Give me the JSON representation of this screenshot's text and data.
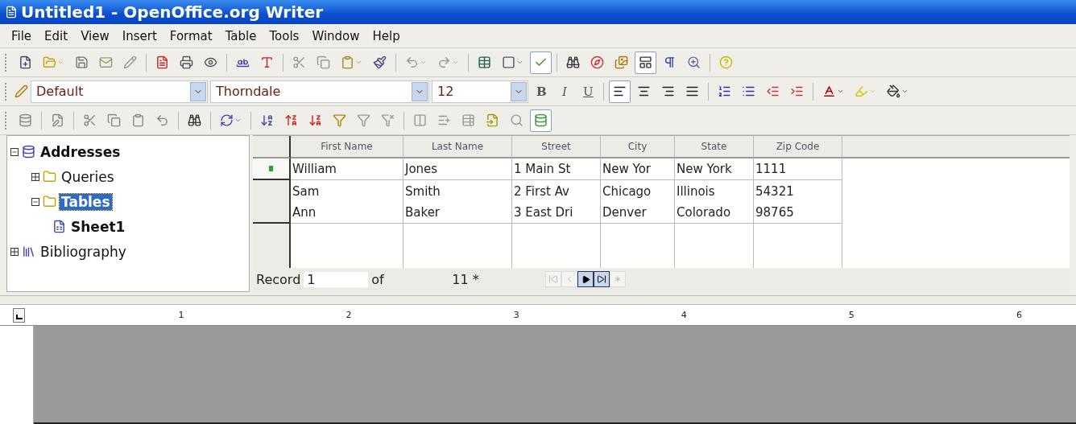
{
  "window": {
    "title": "Untitled1 - OpenOffice.org Writer"
  },
  "menu": [
    "File",
    "Edit",
    "View",
    "Insert",
    "Format",
    "Table",
    "Tools",
    "Window",
    "Help"
  ],
  "toolbar_standard": [
    {
      "kind": "button",
      "on": false
    },
    {
      "kind": "dropdown",
      "on": false
    },
    {
      "kind": "button",
      "on": false
    },
    {
      "kind": "button",
      "on": false
    },
    {
      "kind": "button",
      "on": false
    },
    {
      "kind": "separator"
    },
    {
      "kind": "button",
      "on": false
    },
    {
      "kind": "button",
      "on": false
    },
    {
      "kind": "button",
      "on": false
    },
    {
      "kind": "separator"
    },
    {
      "kind": "button",
      "on": false
    },
    {
      "kind": "button",
      "on": false
    },
    {
      "kind": "separator"
    },
    {
      "kind": "button",
      "on": false
    },
    {
      "kind": "button",
      "on": false
    },
    {
      "kind": "dropdown",
      "on": false
    },
    {
      "kind": "button",
      "on": false
    },
    {
      "kind": "separator"
    },
    {
      "kind": "dropdown",
      "on": false
    },
    {
      "kind": "dropdown",
      "on": false
    },
    {
      "kind": "separator"
    },
    {
      "kind": "button",
      "on": false
    },
    {
      "kind": "dropdown",
      "on": false
    },
    {
      "kind": "button",
      "on": true
    },
    {
      "kind": "separator"
    },
    {
      "kind": "button",
      "on": false
    },
    {
      "kind": "button",
      "on": false
    },
    {
      "kind": "button",
      "on": false
    },
    {
      "kind": "button",
      "on": true
    },
    {
      "kind": "button",
      "on": false
    },
    {
      "kind": "button",
      "on": false
    },
    {
      "kind": "separator"
    },
    {
      "kind": "button",
      "on": false
    }
  ],
  "formatting": {
    "style": "Default",
    "font": "Thorndale",
    "size": "12",
    "format_buttons": [
      {
        "label": "B",
        "kind": "bold",
        "on": false
      },
      {
        "label": "I",
        "kind": "italic",
        "on": false
      },
      {
        "label": "U",
        "kind": "underline",
        "on": false
      }
    ],
    "align_buttons": [
      {
        "on": true
      },
      {
        "on": false
      },
      {
        "on": false
      },
      {
        "on": false
      }
    ]
  },
  "toolbar_data": [
    {
      "kind": "button",
      "on": false
    },
    {
      "kind": "separator"
    },
    {
      "kind": "button",
      "on": false
    },
    {
      "kind": "separator"
    },
    {
      "kind": "button",
      "on": false
    },
    {
      "kind": "button",
      "on": false
    },
    {
      "kind": "button",
      "on": false
    },
    {
      "kind": "button",
      "on": false
    },
    {
      "kind": "separator"
    },
    {
      "kind": "button",
      "on": false
    },
    {
      "kind": "separator"
    },
    {
      "kind": "dropdown",
      "on": false
    },
    {
      "kind": "separator"
    },
    {
      "kind": "button",
      "on": false
    },
    {
      "kind": "button",
      "on": false
    },
    {
      "kind": "button",
      "on": false
    },
    {
      "kind": "button",
      "on": false
    },
    {
      "kind": "button",
      "on": false
    },
    {
      "kind": "button",
      "on": false
    },
    {
      "kind": "separator"
    },
    {
      "kind": "button",
      "on": false
    },
    {
      "kind": "button",
      "on": false
    },
    {
      "kind": "button",
      "on": false
    },
    {
      "kind": "button",
      "on": false
    },
    {
      "kind": "button",
      "on": false
    },
    {
      "kind": "button",
      "on": true
    }
  ],
  "tree": [
    {
      "label": "Addresses",
      "bold": true,
      "expanded": true,
      "selected": false,
      "children": [
        {
          "label": "Queries",
          "bold": false,
          "expanded": false,
          "selected": false
        },
        {
          "label": "Tables",
          "bold": true,
          "expanded": true,
          "selected": true,
          "children": [
            {
              "label": "Sheet1",
              "bold": true,
              "selected": false
            }
          ]
        }
      ]
    },
    {
      "label": "Bibliography",
      "bold": false,
      "expanded": false,
      "selected": false
    }
  ],
  "table": {
    "columns": [
      "First Name",
      "Last Name",
      "Street",
      "City",
      "State",
      "Zip Code"
    ],
    "rows": [
      {
        "current": true,
        "cells": [
          "William",
          "Jones",
          "1 Main St",
          "New Yor",
          "New York",
          "1111"
        ]
      },
      {
        "current": false,
        "cells": [
          "Sam",
          "Smith",
          "2 First Av",
          "Chicago",
          "Illinois",
          "54321"
        ]
      },
      {
        "current": false,
        "cells": [
          "Ann",
          "Baker",
          "3 East Dri",
          "Denver",
          "Colorado",
          "98765"
        ]
      }
    ]
  },
  "record_bar": {
    "label": "Record",
    "value": "1",
    "of": "of",
    "count": "11 *"
  },
  "ruler": [
    "1",
    "2",
    "3",
    "4",
    "5",
    "6"
  ]
}
